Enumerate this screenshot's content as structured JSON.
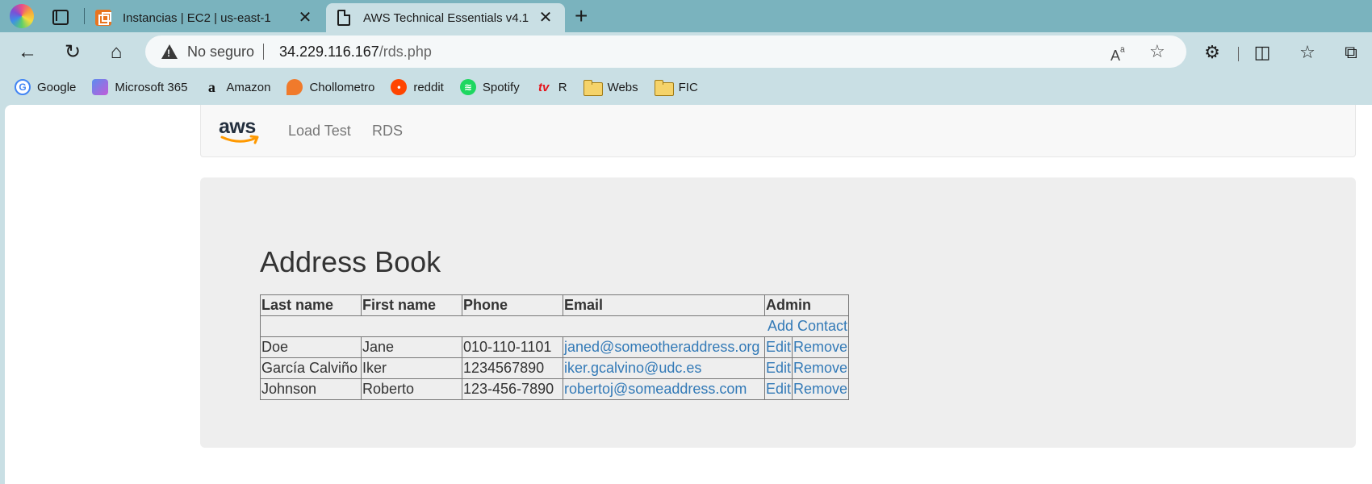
{
  "browser": {
    "tabs": [
      {
        "title": "Instancias | EC2 | us-east-1",
        "active": false,
        "icon": "ec2-icon"
      },
      {
        "title": "AWS Technical Essentials v4.1",
        "active": true,
        "icon": "document-icon"
      }
    ],
    "address": {
      "security_label": "No seguro",
      "host": "34.229.116.167",
      "path": "/rds.php"
    },
    "bookmarks": [
      {
        "label": "Google",
        "icon": "google-icon"
      },
      {
        "label": "Microsoft 365",
        "icon": "microsoft-365-icon"
      },
      {
        "label": "Amazon",
        "icon": "amazon-icon"
      },
      {
        "label": "Chollometro",
        "icon": "chollometro-icon"
      },
      {
        "label": "reddit",
        "icon": "reddit-icon"
      },
      {
        "label": "Spotify",
        "icon": "spotify-icon"
      },
      {
        "label": "R",
        "icon": "rtve-icon",
        "icon_text": "tv"
      },
      {
        "label": "Webs",
        "icon": "folder-icon"
      },
      {
        "label": "FIC",
        "icon": "folder-icon"
      }
    ]
  },
  "site": {
    "logo_text": "aws",
    "nav": [
      {
        "label": "Load Test"
      },
      {
        "label": "RDS"
      }
    ],
    "title": "Address Book",
    "table": {
      "headers": [
        "Last name",
        "First name",
        "Phone",
        "Email",
        "Admin"
      ],
      "add_contact": "Add Contact",
      "edit_label": "Edit",
      "remove_label": "Remove",
      "rows": [
        {
          "last": "Doe",
          "first": "Jane",
          "phone": "010-110-1101",
          "email": "janed@someotheraddress.org"
        },
        {
          "last": "García Calviño",
          "first": "Iker",
          "phone": "1234567890",
          "email": "iker.gcalvino@udc.es"
        },
        {
          "last": "Johnson",
          "first": "Roberto",
          "phone": "123-456-7890",
          "email": "robertoj@someaddress.com"
        }
      ]
    }
  },
  "colors": {
    "tabstrip": "#7ab3be",
    "toolbar": "#c9dfe4",
    "link": "#337ab7",
    "aws_orange": "#ff9900"
  }
}
